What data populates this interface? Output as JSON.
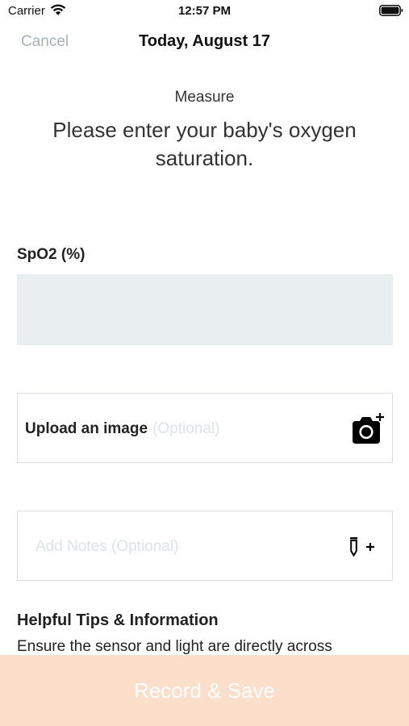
{
  "status_bar": {
    "carrier": "Carrier",
    "time": "12:57 PM",
    "wifi_icon": "wifi-icon",
    "battery_icon": "battery-full-icon"
  },
  "nav": {
    "cancel_label": "Cancel",
    "title": "Today, August 17"
  },
  "header": {
    "section_label": "Measure",
    "instruction": "Please enter your baby's oxygen saturation."
  },
  "spo2": {
    "label": "SpO2 (%)",
    "value": ""
  },
  "upload": {
    "label": "Upload an image",
    "optional_note": "(Optional)",
    "icon": "camera-add-icon"
  },
  "notes": {
    "placeholder": "Add Notes (Optional)",
    "icon": "pencil-add-icon"
  },
  "tips": {
    "title": "Helpful Tips & Information",
    "text": "Ensure the sensor and light are directly across"
  },
  "footer": {
    "record_label": "Record & Save"
  },
  "colors": {
    "accent_disabled": "#fcdfcb",
    "input_bg": "#e9efef",
    "cancel_text": "#a6b1b8",
    "placeholder": "#dde3e6"
  }
}
